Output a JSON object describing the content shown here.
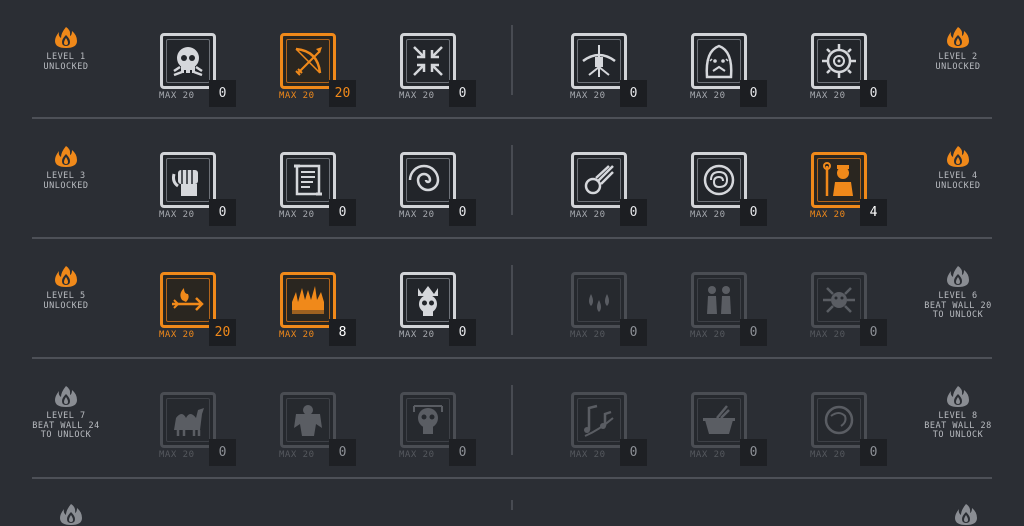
{
  "colors": {
    "background": "#2b2e34",
    "unlocked_accent": "#f0891a",
    "tile_border": "#d2d4d8",
    "locked_border": "#4a4d53"
  },
  "levels": [
    {
      "id": "level-1",
      "side": "left",
      "lines": [
        "LEVEL 1",
        "UNLOCKED"
      ],
      "unlocked": true,
      "skills": [
        {
          "icon": "skull-icon",
          "label": "MAX 20",
          "count": "0",
          "state": "normal"
        },
        {
          "icon": "bow-arrow-icon",
          "label": "MAX 20",
          "count": "20",
          "state": "active"
        },
        {
          "icon": "compress-arrows-icon",
          "label": "MAX 20",
          "count": "0",
          "state": "normal"
        }
      ]
    },
    {
      "id": "level-2",
      "side": "right",
      "lines": [
        "LEVEL 2",
        "UNLOCKED"
      ],
      "unlocked": true,
      "skills": [
        {
          "icon": "turret-icon",
          "label": "MAX 20",
          "count": "0",
          "state": "normal"
        },
        {
          "icon": "hooded-figure-icon",
          "label": "MAX 20",
          "count": "0",
          "state": "normal"
        },
        {
          "icon": "target-gear-icon",
          "label": "MAX 20",
          "count": "0",
          "state": "normal"
        }
      ]
    },
    {
      "id": "level-3",
      "side": "left",
      "lines": [
        "LEVEL 3",
        "UNLOCKED"
      ],
      "unlocked": true,
      "skills": [
        {
          "icon": "fist-icon",
          "label": "MAX 20",
          "count": "0",
          "state": "normal"
        },
        {
          "icon": "scroll-icon",
          "label": "MAX 20",
          "count": "0",
          "state": "normal"
        },
        {
          "icon": "vortex-icon",
          "label": "MAX 20",
          "count": "0",
          "state": "normal"
        }
      ]
    },
    {
      "id": "level-4",
      "side": "right",
      "lines": [
        "LEVEL 4",
        "UNLOCKED"
      ],
      "unlocked": true,
      "skills": [
        {
          "icon": "comet-icon",
          "label": "MAX 20",
          "count": "0",
          "state": "normal"
        },
        {
          "icon": "brain-icon",
          "label": "MAX 20",
          "count": "0",
          "state": "normal"
        },
        {
          "icon": "staff-wizard-icon",
          "label": "MAX 20",
          "count": "4",
          "state": "active"
        }
      ]
    },
    {
      "id": "level-5",
      "side": "left",
      "lines": [
        "LEVEL 5",
        "UNLOCKED"
      ],
      "unlocked": true,
      "skills": [
        {
          "icon": "fire-arrow-icon",
          "label": "MAX 20",
          "count": "20",
          "state": "active"
        },
        {
          "icon": "flames-icon",
          "label": "MAX 20",
          "count": "8",
          "state": "active"
        },
        {
          "icon": "crowned-skull-icon",
          "label": "MAX 20",
          "count": "0",
          "state": "normal"
        }
      ]
    },
    {
      "id": "level-6",
      "side": "right",
      "lines": [
        "LEVEL 6",
        "BEAT WALL 20",
        "TO UNLOCK"
      ],
      "unlocked": false,
      "skills": [
        {
          "icon": "drops-icon",
          "label": "MAX 20",
          "count": "0",
          "state": "locked"
        },
        {
          "icon": "figures-icon",
          "label": "MAX 20",
          "count": "0",
          "state": "locked"
        },
        {
          "icon": "swarm-icon",
          "label": "MAX 20",
          "count": "0",
          "state": "locked"
        }
      ]
    },
    {
      "id": "level-7",
      "side": "left",
      "lines": [
        "LEVEL 7",
        "BEAT WALL 24",
        "TO UNLOCK"
      ],
      "unlocked": false,
      "skills": [
        {
          "icon": "camel-icon",
          "label": "MAX 20",
          "count": "0",
          "state": "locked"
        },
        {
          "icon": "golem-icon",
          "label": "MAX 20",
          "count": "0",
          "state": "locked"
        },
        {
          "icon": "skull-banner-icon",
          "label": "MAX 20",
          "count": "0",
          "state": "locked"
        }
      ]
    },
    {
      "id": "level-8",
      "side": "right",
      "lines": [
        "LEVEL 8",
        "BEAT WALL 28",
        "TO UNLOCK"
      ],
      "unlocked": false,
      "skills": [
        {
          "icon": "music-notes-icon",
          "label": "MAX 20",
          "count": "0",
          "state": "locked"
        },
        {
          "icon": "cauldron-icon",
          "label": "MAX 20",
          "count": "0",
          "state": "locked"
        },
        {
          "icon": "orb-icon",
          "label": "MAX 20",
          "count": "0",
          "state": "locked"
        }
      ]
    }
  ]
}
